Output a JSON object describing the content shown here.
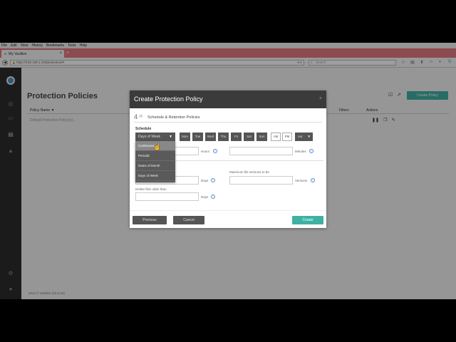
{
  "browser": {
    "menu": [
      "File",
      "Edit",
      "View",
      "History",
      "Bookmarks",
      "Tools",
      "Help"
    ],
    "tab_title": "My Vaultize",
    "tab_close": "×",
    "new_tab": "+",
    "url": "https://192.168.1.218/protection/#",
    "search_placeholder": "Search"
  },
  "app": {
    "page_title": "Protection Policies",
    "create_policy": "Create Policy",
    "table": {
      "headers": {
        "name": "Policy Name ▼",
        "filters": "Filters",
        "actions": "Actions"
      },
      "rows": [
        {
          "name": "Default Protection Policy(s)..."
        }
      ]
    },
    "footer": "2014 © Vaultize (10.8.24)"
  },
  "modal": {
    "title": "Create Protection Policy",
    "close": "×",
    "step": {
      "current": "4",
      "total": "/4",
      "label": "Schedule & Retention Policies"
    },
    "schedule_label": "Schedule",
    "schedule_selected": "Days of Week",
    "schedule_options": [
      "Continuous",
      "Periodic",
      "Dates of Month",
      "Days of Week"
    ],
    "days": [
      "Mon",
      "Tue",
      "Wed",
      "Thu",
      "Fri",
      "Sat",
      "Sun"
    ],
    "am": "AM",
    "pm": "PM",
    "hour": "out",
    "units": {
      "hours": "Hours",
      "minutes": "Minutes",
      "days": "Days",
      "versions": "Versions"
    },
    "labels": {
      "max_versions": "Maximum file versions to be",
      "delete_older": "Delete files older than"
    },
    "buttons": {
      "previous": "Previous",
      "cancel": "Cancel",
      "create": "Create"
    }
  },
  "colors": {
    "accent": "#3fb1a3",
    "tab_bar": "#e47982",
    "sidebar": "#2c2c2c",
    "modal_header": "#3b3b3b"
  }
}
